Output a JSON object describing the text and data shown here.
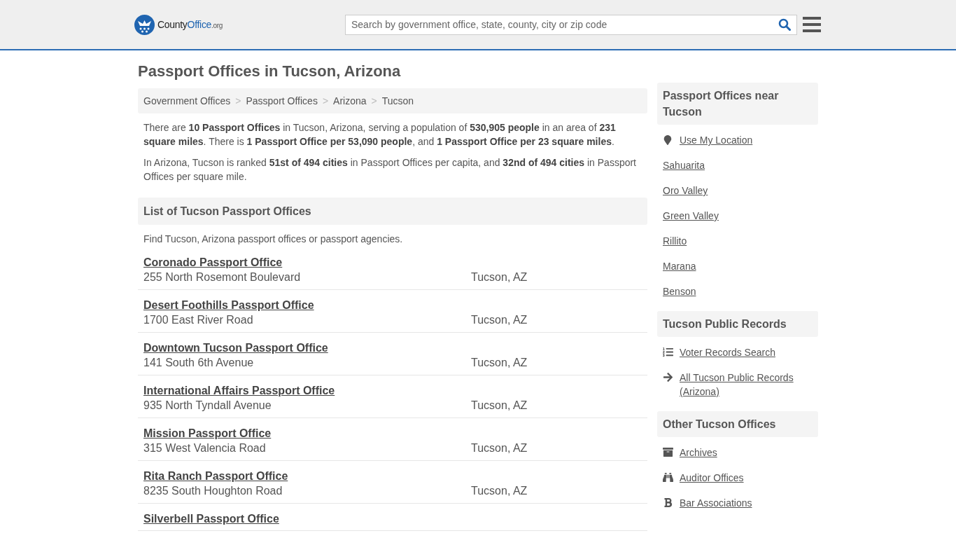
{
  "header": {
    "logo": {
      "name": "County",
      "highlight": "Office",
      "suffix": ".org"
    },
    "search": {
      "placeholder": "Search by government office, state, county, city or zip code"
    }
  },
  "title": "Passport Offices in Tucson, Arizona",
  "breadcrumbs": [
    "Government Offices",
    "Passport Offices",
    "Arizona",
    "Tucson"
  ],
  "breadcrumb_separator": ">",
  "intro": [
    "There are **10 Passport Offices** in Tucson, Arizona, serving a population of **530,905 people** in an area of **231 square miles**. There is **1 Passport Office per 53,090 people**, and **1 Passport Office per 23 square miles**.",
    "In Arizona, Tucson is ranked **51st of 494 cities** in Passport Offices per capita, and **32nd of 494 cities** in Passport Offices per square mile."
  ],
  "list": {
    "heading": "List of Tucson Passport Offices",
    "description": "Find Tucson, Arizona passport offices or passport agencies.",
    "offices": [
      {
        "name": "Coronado Passport Office",
        "address": "255 North Rosemont Boulevard",
        "city": "Tucson, AZ"
      },
      {
        "name": "Desert Foothills Passport Office",
        "address": "1700 East River Road",
        "city": "Tucson, AZ"
      },
      {
        "name": "Downtown Tucson Passport Office",
        "address": "141 South 6th Avenue",
        "city": "Tucson, AZ"
      },
      {
        "name": "International Affairs Passport Office",
        "address": "935 North Tyndall Avenue",
        "city": "Tucson, AZ"
      },
      {
        "name": "Mission Passport Office",
        "address": "315 West Valencia Road",
        "city": "Tucson, AZ"
      },
      {
        "name": "Rita Ranch Passport Office",
        "address": "8235 South Houghton Road",
        "city": "Tucson, AZ"
      },
      {
        "name": "Silverbell Passport Office"
      }
    ]
  },
  "sidebar": [
    {
      "heading": "Passport Offices near Tucson",
      "links": [
        {
          "label": "Use My Location",
          "kind": "icon"
        },
        {
          "label": "Sahuarita",
          "kind": "plain"
        },
        {
          "label": "Oro Valley",
          "kind": "plain"
        },
        {
          "label": "Green Valley",
          "kind": "plain"
        },
        {
          "label": "Rillito",
          "kind": "plain"
        },
        {
          "label": "Marana",
          "kind": "plain"
        },
        {
          "label": "Benson",
          "kind": "plain"
        }
      ]
    },
    {
      "heading": "Tucson Public Records",
      "links": [
        {
          "label": "Voter Records Search",
          "kind": "icon"
        },
        {
          "label": "All Tucson Public Records (Arizona)",
          "kind": "icon"
        }
      ]
    },
    {
      "heading": "Other Tucson Offices",
      "links": [
        {
          "label": "Archives",
          "kind": "icon"
        },
        {
          "label": "Auditor Offices",
          "kind": "icon"
        },
        {
          "label": "Bar Associations",
          "kind": "icon"
        }
      ]
    }
  ]
}
